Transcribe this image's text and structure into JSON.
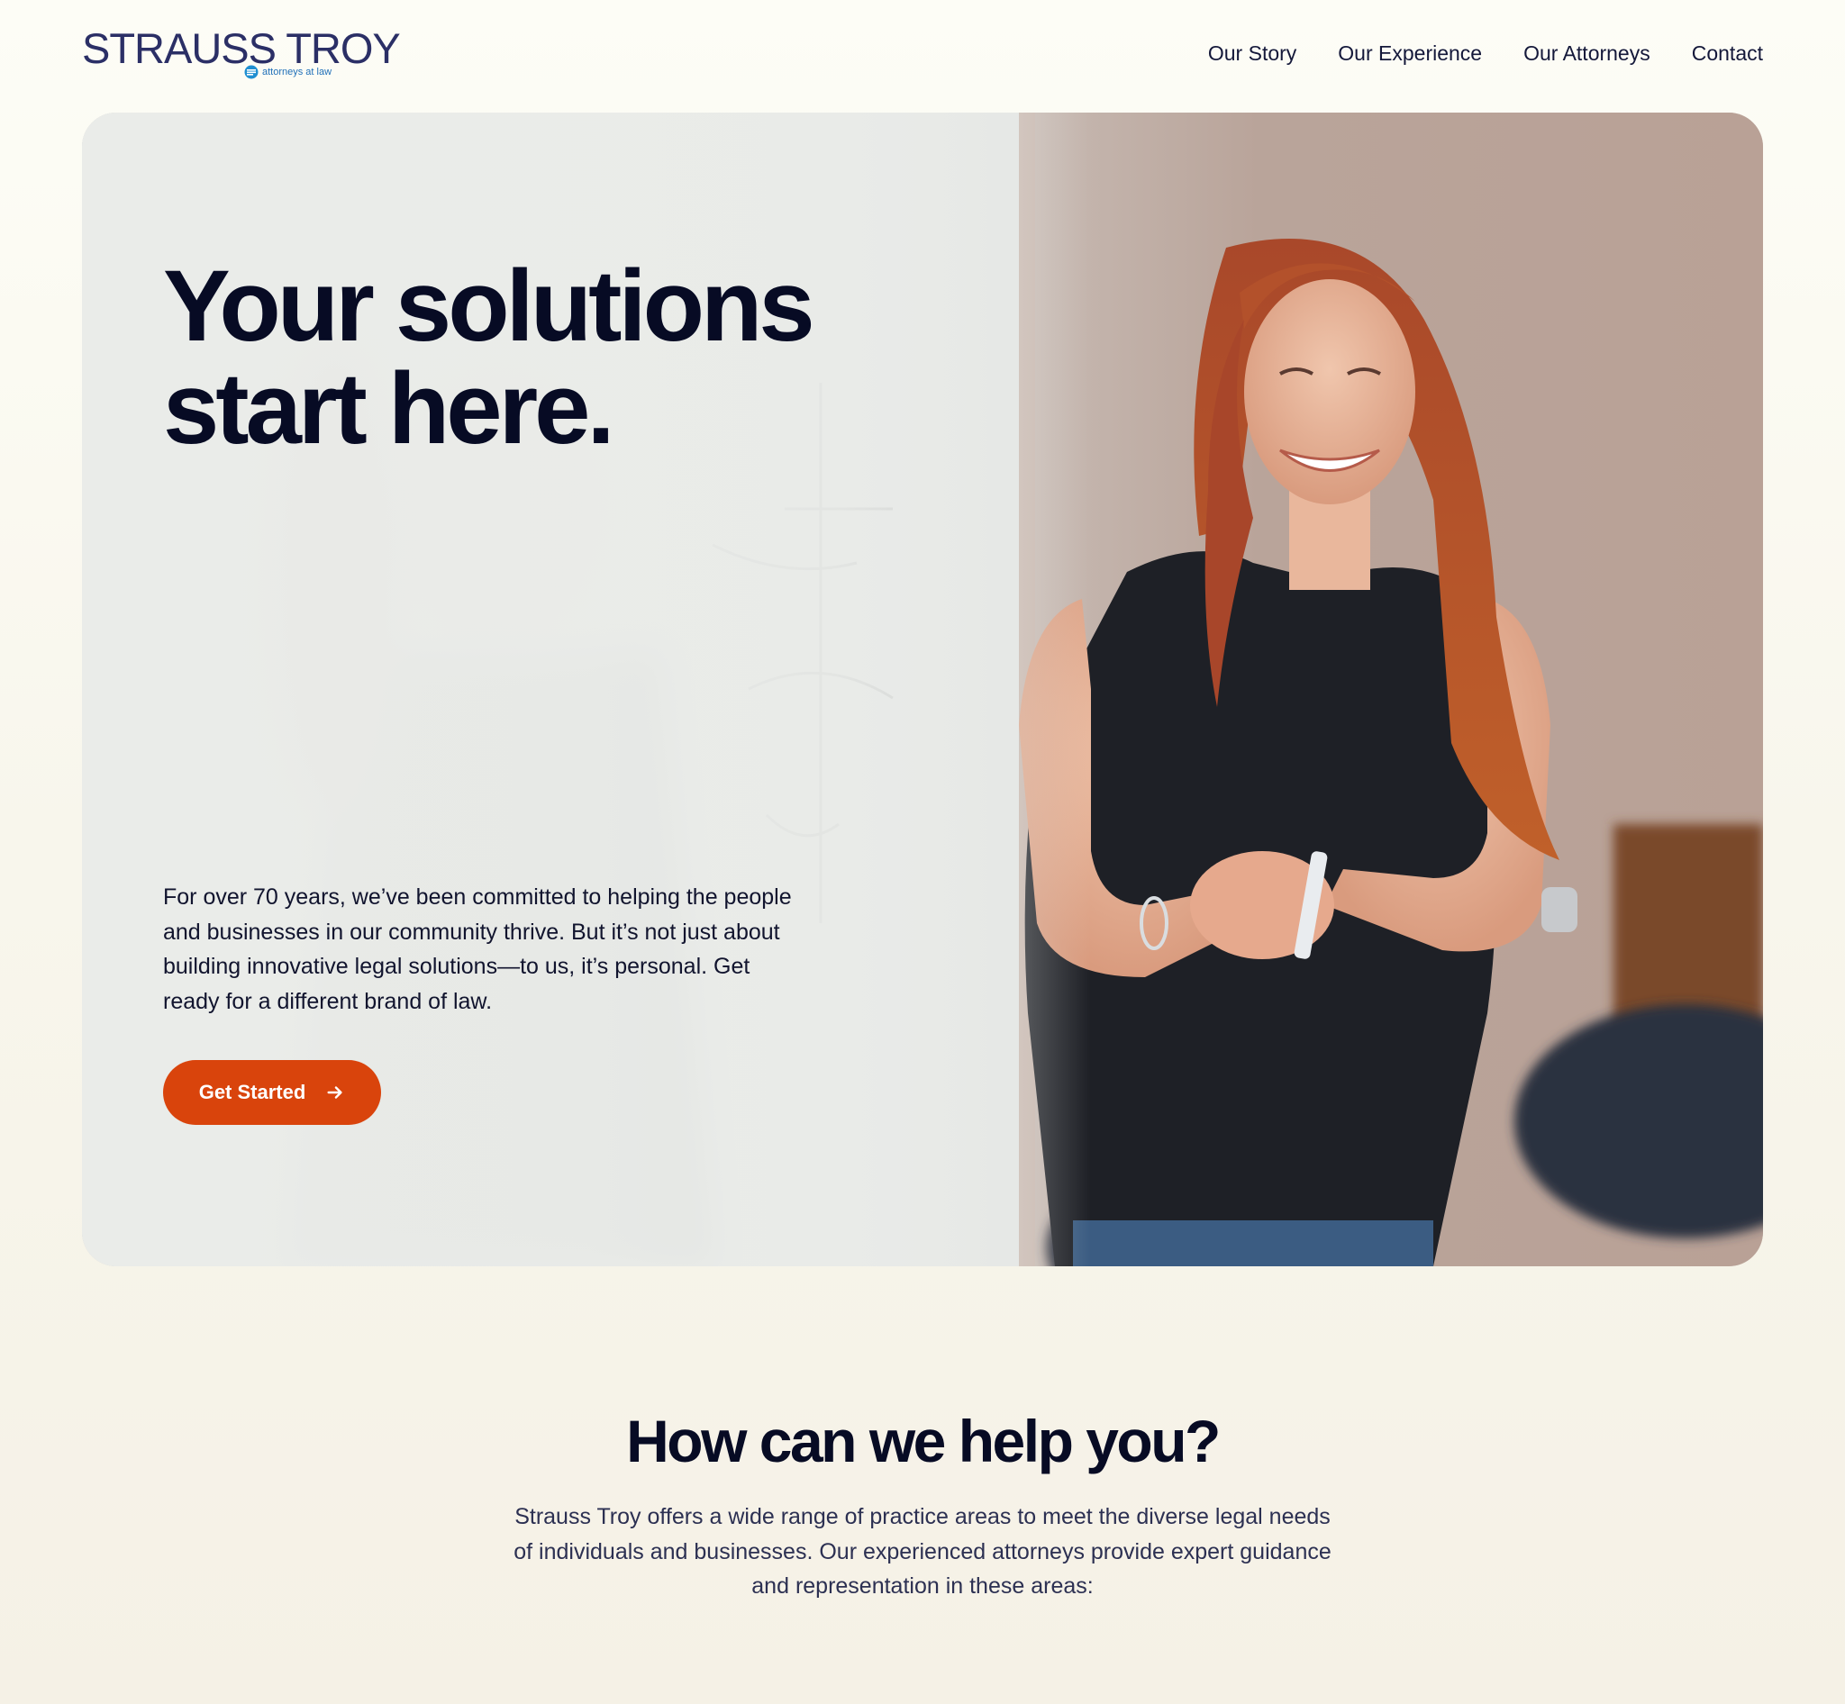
{
  "header": {
    "logo": {
      "wordmark": "STRAUSS TROY",
      "tagline": "attorneys at law",
      "icon": "strauss-troy-mark-icon"
    },
    "nav": [
      {
        "label": "Our Story"
      },
      {
        "label": "Our Experience"
      },
      {
        "label": "Our Attorneys"
      },
      {
        "label": "Contact"
      }
    ]
  },
  "hero": {
    "title_line1": "Your solutions",
    "title_line2": "start here.",
    "body": "For over 70 years, we’ve been committed to helping the people and businesses in our community thrive. But it’s not just about building innovative legal solutions—to us, it’s personal. Get ready for a different brand of law.",
    "cta_label": "Get Started",
    "cta_icon": "arrow-right-icon",
    "image_alt": "Smiling woman with red hair standing in an office near a whiteboard"
  },
  "help": {
    "title": "How can we help you?",
    "body": "Strauss Troy offers a wide range of practice areas to meet the diverse legal needs of individuals and businesses. Our experienced attorneys provide expert guidance and representation in these areas:"
  },
  "colors": {
    "brand_navy": "#2b2f66",
    "accent_orange": "#d9440c",
    "logo_blue": "#1f6fb8",
    "page_bg": "#f8f6ec",
    "heading": "#070b24"
  }
}
